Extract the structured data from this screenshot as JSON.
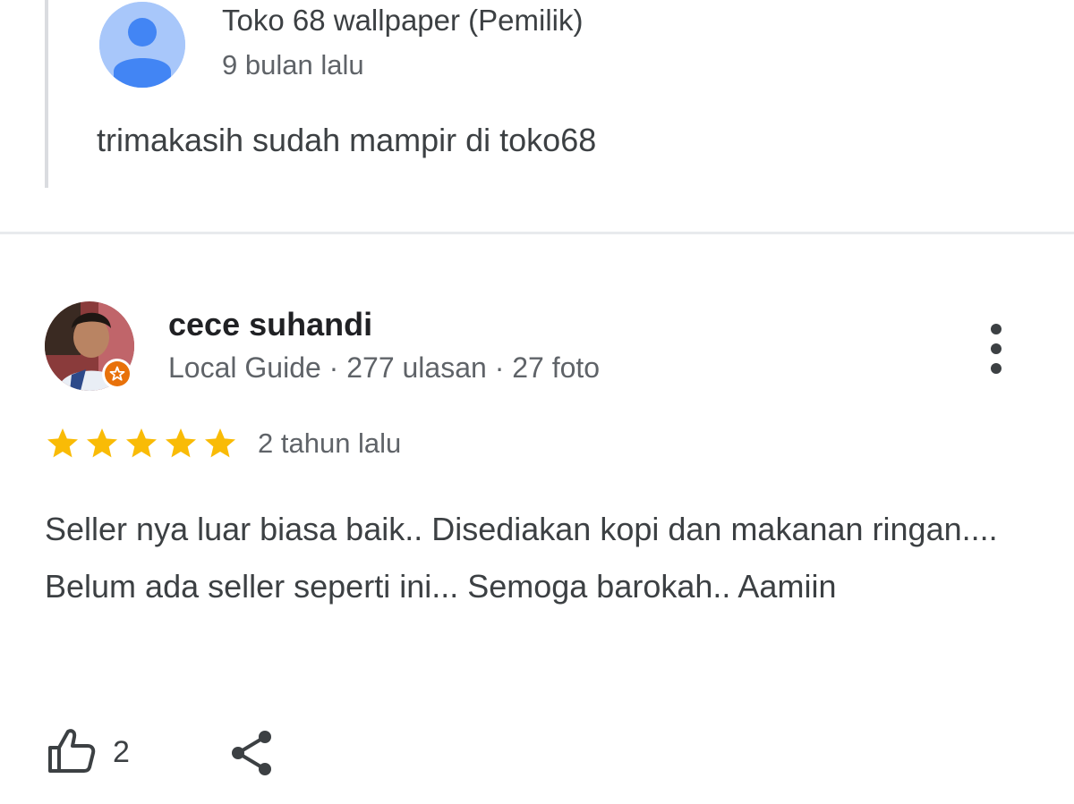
{
  "owner_reply": {
    "name": "Toko 68 wallpaper (Pemilik)",
    "time": "9 bulan lalu",
    "text": "trimakasih sudah mampir di toko68",
    "avatar_icon": "person-icon",
    "avatar_color": "#a8c7fa"
  },
  "review": {
    "reviewer_name": "cece suhandi",
    "reviewer_meta": "Local Guide · 277 ulasan · 27 foto",
    "rating": 5,
    "rating_max": 5,
    "time": "2 tahun lalu",
    "text": "Seller nya luar biasa baik.. Disediakan kopi dan makanan ringan.... Belum ada seller seperti ini... Semoga barokah.. Aamiin",
    "like_count": "2",
    "star_color": "#f9bb06",
    "badge_color": "#e8710a"
  },
  "icons": {
    "more": "more-vert-icon",
    "like": "thumbs-up-icon",
    "share": "share-icon"
  }
}
